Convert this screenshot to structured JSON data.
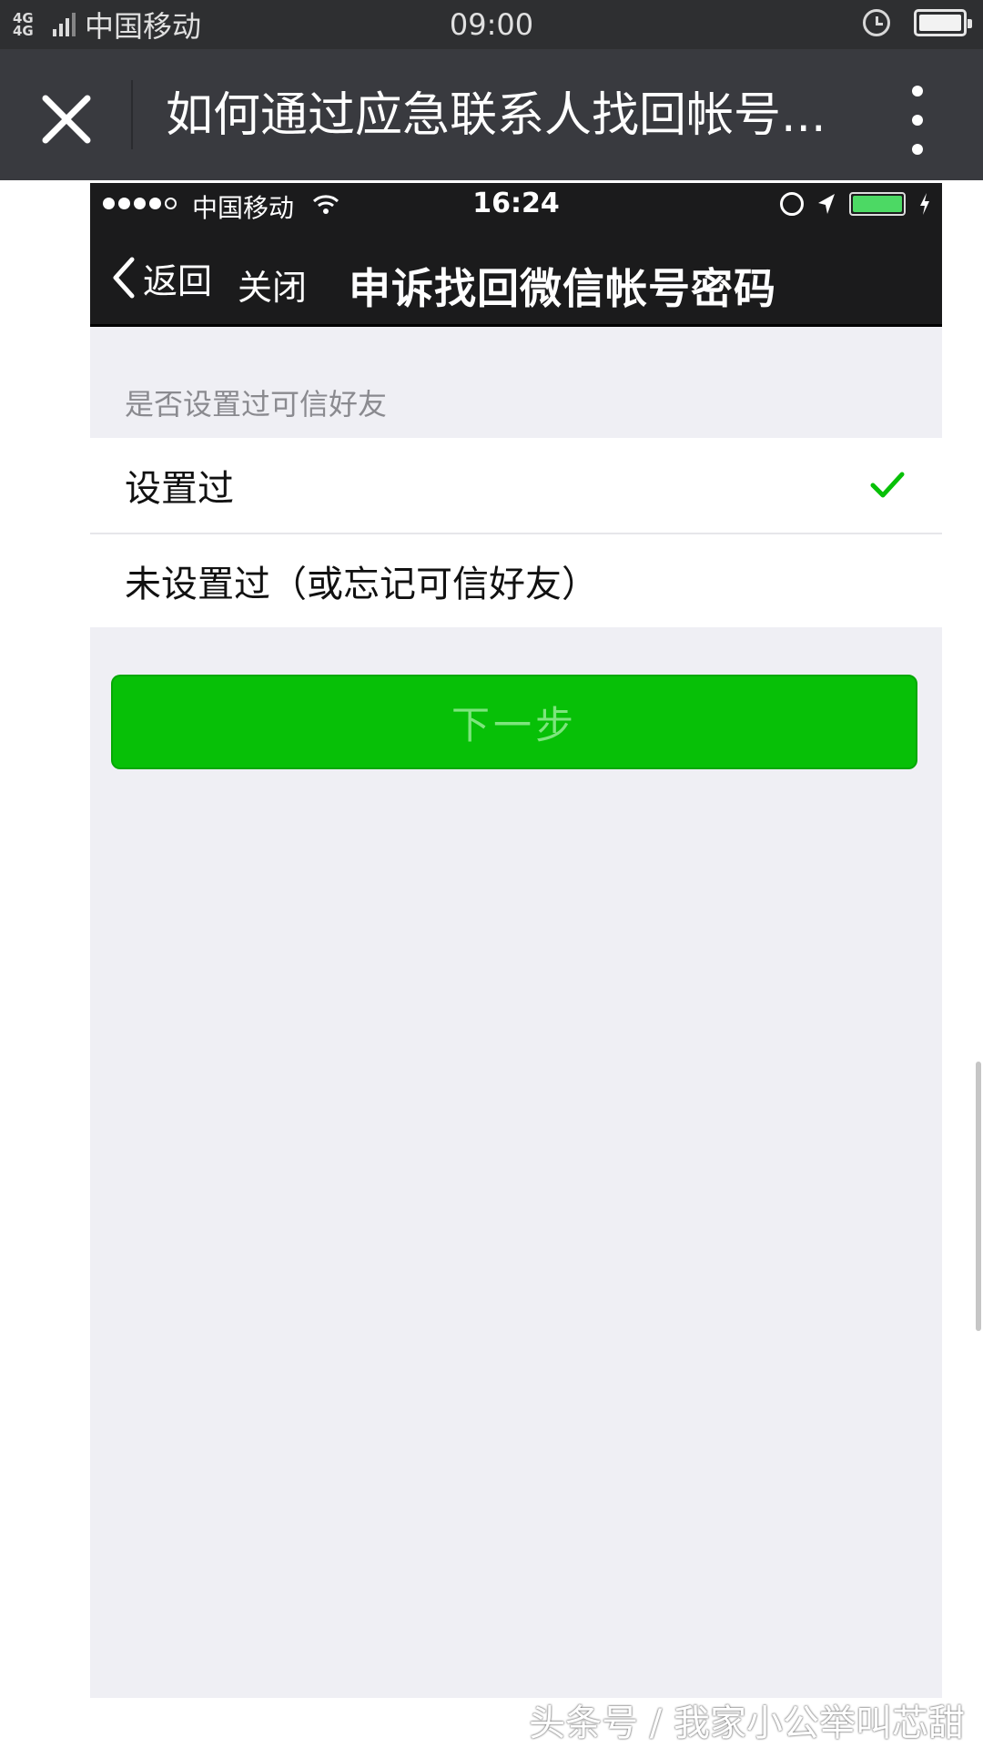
{
  "system_status": {
    "network": "4G 4G",
    "carrier": "中国移动",
    "time": "09:00"
  },
  "webview": {
    "title": "如何通过应急联系人找回帐号..."
  },
  "embedded_screenshot": {
    "ios_status": {
      "carrier": "中国移动",
      "time": "16:24"
    },
    "nav": {
      "back_label": "返回",
      "close_label": "关闭",
      "title": "申诉找回微信帐号密码"
    },
    "section_header": "是否设置过可信好友",
    "options": [
      {
        "label": "设置过",
        "selected": true
      },
      {
        "label": "未设置过（或忘记可信好友）",
        "selected": false
      }
    ],
    "next_button": "下一步",
    "colors": {
      "accent": "#07c007",
      "check": "#07c007",
      "background": "#efeff4"
    }
  },
  "watermark": "头条号 / 我家小公举叫芯甜"
}
